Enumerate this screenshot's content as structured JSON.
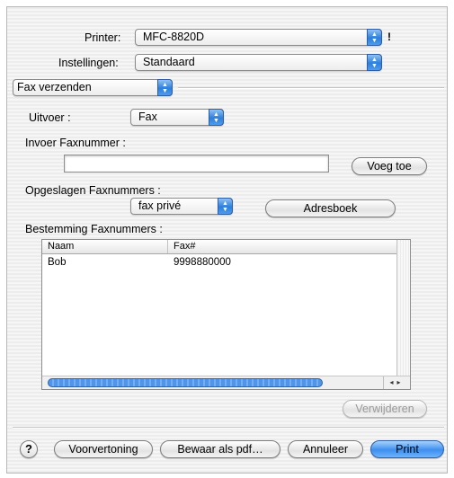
{
  "printer": {
    "label": "Printer:",
    "value": "MFC-8820D",
    "status_glyph": "!"
  },
  "settings": {
    "label": "Instellingen:",
    "value": "Standaard"
  },
  "panel_menu": {
    "value": "Fax verzenden"
  },
  "output": {
    "label": "Uitvoer :",
    "value": "Fax"
  },
  "fax_input": {
    "label": "Invoer Faxnummer :",
    "value": "",
    "add_button": "Voeg toe"
  },
  "saved": {
    "label": "Opgeslagen Faxnummers :",
    "value": "fax privé",
    "addressbook_button": "Adresboek"
  },
  "destination": {
    "label": "Bestemming Faxnummers :",
    "columns": [
      "Naam",
      "Fax#"
    ],
    "rows": [
      {
        "name": "Bob",
        "fax": "9998880000"
      }
    ],
    "delete_button": "Verwijderen"
  },
  "footer": {
    "help_glyph": "?",
    "preview_button": "Voorvertoning",
    "save_pdf_button": "Bewaar als pdf…",
    "cancel_button": "Annuleer",
    "print_button": "Print"
  },
  "colors": {
    "accent": "#3d8ff0",
    "accent_border": "#2f5fa6",
    "background_stripe": "#ececec"
  }
}
